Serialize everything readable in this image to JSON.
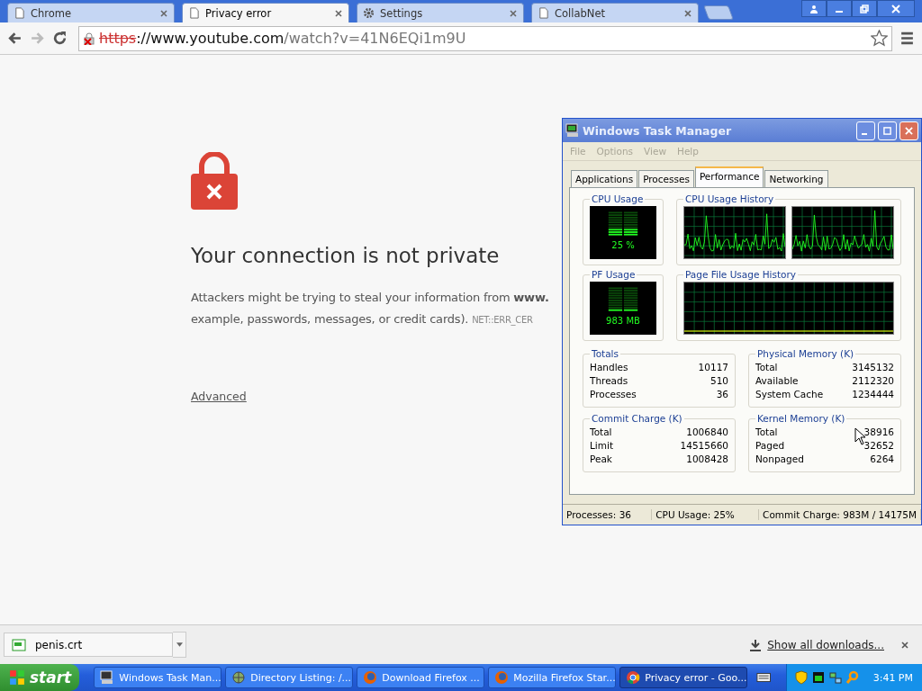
{
  "browser_tabs": [
    {
      "title": "Chrome",
      "kind": "page",
      "selected": false
    },
    {
      "title": "Privacy error",
      "kind": "page",
      "selected": true
    },
    {
      "title": "Settings",
      "kind": "settings",
      "selected": false
    },
    {
      "title": "CollabNet",
      "kind": "page",
      "selected": false
    }
  ],
  "address_bar": {
    "scheme": "https",
    "host": "://www.youtube.com",
    "path": "/watch?v=41N6EQi1m9U"
  },
  "error_page": {
    "heading": "Your connection is not private",
    "line_1": "Attackers might be trying to steal your information from **www.**",
    "line_2": "example, passwords, messages, or credit cards).",
    "error_code": "NET::ERR_CER",
    "advanced_link": "Advanced"
  },
  "task_manager": {
    "title": "Windows Task Manager",
    "menu": [
      {
        "label": "File",
        "disabled": true
      },
      {
        "label": "Options",
        "disabled": true
      },
      {
        "label": "View",
        "disabled": true
      },
      {
        "label": "Help",
        "disabled": true
      }
    ],
    "tabs": [
      {
        "label": "Applications",
        "selected": false
      },
      {
        "label": "Processes",
        "selected": false
      },
      {
        "label": "Performance",
        "selected": true
      },
      {
        "label": "Networking",
        "selected": false
      }
    ],
    "cpu_usage": {
      "title": "CPU Usage",
      "reading": "25 %",
      "level": 0.25
    },
    "cpu_history": {
      "title": "CPU Usage History"
    },
    "pf_usage": {
      "title": "PF Usage",
      "reading": "983 MB",
      "level": 0.07
    },
    "pf_history": {
      "title": "Page File Usage History"
    },
    "groups": [
      {
        "title": "Totals",
        "rows": [
          [
            "Handles",
            "10117"
          ],
          [
            "Threads",
            "510"
          ],
          [
            "Processes",
            "36"
          ]
        ]
      },
      {
        "title": "Physical Memory (K)",
        "rows": [
          [
            "Total",
            "3145132"
          ],
          [
            "Available",
            "2112320"
          ],
          [
            "System Cache",
            "1234444"
          ]
        ]
      },
      {
        "title": "Commit Charge (K)",
        "rows": [
          [
            "Total",
            "1006840"
          ],
          [
            "Limit",
            "14515660"
          ],
          [
            "Peak",
            "1008428"
          ]
        ]
      },
      {
        "title": "Kernel Memory (K)",
        "rows": [
          [
            "Total",
            "38916"
          ],
          [
            "Paged",
            "32652"
          ],
          [
            "Nonpaged",
            "6264"
          ]
        ]
      }
    ],
    "status_bar": [
      "Processes: 36",
      "CPU Usage: 25%",
      "Commit Charge: 983M / 14175M"
    ]
  },
  "download_bar": {
    "file": "penis.crt",
    "show_all": "Show all downloads..."
  },
  "taskbar": {
    "start": "start",
    "items": [
      {
        "label": "Windows Task Man...",
        "kind": "app",
        "selected": false
      },
      {
        "label": "Directory Listing: /...",
        "kind": "folder",
        "selected": false
      },
      {
        "label": "Download Firefox ...",
        "kind": "browser",
        "selected": false
      },
      {
        "label": "Mozilla Firefox Star...",
        "kind": "browser",
        "selected": false
      },
      {
        "label": "Privacy error - Goo...",
        "kind": "web",
        "selected": true
      }
    ],
    "clock": "3:41 PM"
  }
}
